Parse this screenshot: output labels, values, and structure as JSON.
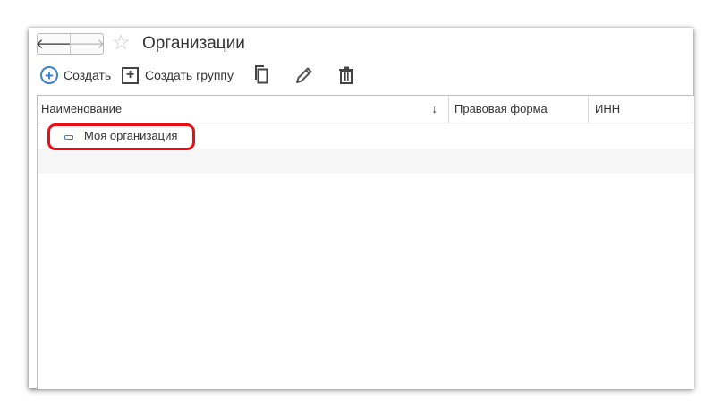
{
  "header": {
    "back_arrow": "🡐",
    "forward_arrow": "🡒",
    "favorite_star": "☆",
    "title": "Организации"
  },
  "toolbar": {
    "create_icon": "+",
    "create_label": "Создать",
    "create_group_icon": "+",
    "create_group_label": "Создать группу",
    "copy_icon": "copy-icon",
    "edit_icon": "pencil-icon",
    "delete_icon": "trash-icon"
  },
  "table": {
    "columns": {
      "name": "Наименование",
      "sort_indicator": "↓",
      "legal_form": "Правовая форма",
      "inn": "ИНН"
    },
    "rows": [
      {
        "name": "Моя организация",
        "legal_form": "",
        "inn": ""
      }
    ]
  },
  "colors": {
    "accent": "#3a7fd0",
    "highlight": "#e81016"
  }
}
